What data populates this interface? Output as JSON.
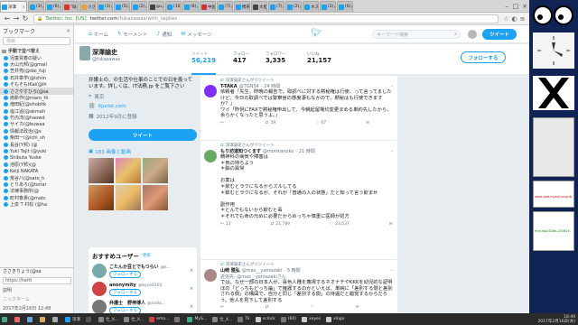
{
  "browser": {
    "tabs": [
      {
        "label": "深澤",
        "color": "#1da1f2",
        "active": true
      },
      {
        "label": "(3)",
        "color": "#1da1f2"
      },
      {
        "label": "(6)",
        "color": "#1da1f2"
      },
      {
        "label": "\"既",
        "color": "#d33"
      },
      {
        "label": "小さ",
        "color": "#e6a23c"
      },
      {
        "label": "(3)",
        "color": "#1da1f2"
      },
      {
        "label": "(5)",
        "color": "#1da1f2"
      },
      {
        "label": "(2)",
        "color": "#1da1f2"
      },
      {
        "label": "gu",
        "color": "#444"
      },
      {
        "label": "(10)",
        "color": "#1da1f2"
      },
      {
        "label": "(8)",
        "color": "#1da1f2"
      },
      {
        "label": "中国",
        "color": "#c33"
      },
      {
        "label": "(7)",
        "color": "#1da1f2"
      },
      {
        "label": "携帯",
        "color": "#1da1f2"
      },
      {
        "label": "大胆",
        "color": "#444"
      },
      {
        "label": "(7)",
        "color": "#1da1f2"
      },
      {
        "label": "(2)",
        "color": "#1da1f2"
      },
      {
        "label": "ネス",
        "color": "#1da1f2"
      },
      {
        "label": "(2)",
        "color": "#1da1f2"
      },
      {
        "label": "(6)",
        "color": "#1da1f2"
      }
    ],
    "url_scheme": "Twitter, Inc. [US]",
    "url_host": "twitter.com",
    "url_path": "/fukazawas/with_replies"
  },
  "bookmarks": {
    "title": "ブックマーク",
    "search_placeholder": "検索",
    "items": [
      {
        "label": "手動で並べ替え",
        "type": "folder"
      },
      {
        "label": "児童買春の疑い",
        "type": "tw"
      },
      {
        "label": "大山元邦(@gmail",
        "type": "tw"
      },
      {
        "label": "笠井亮(@dai_fuji",
        "type": "tw"
      },
      {
        "label": "石井章学(@ishiin",
        "type": "tw"
      },
      {
        "label": "そもそもIKai(@ih",
        "type": "tw"
      },
      {
        "label": "ささやすひろ(@sa",
        "type": "tw",
        "selected": true
      },
      {
        "label": "南新作(@maro_th",
        "type": "tw"
      },
      {
        "label": "増田紀(@shobitk",
        "type": "tw"
      },
      {
        "label": "塩江遥(@akmah",
        "type": "tw"
      },
      {
        "label": "竹内洋(@haowd",
        "type": "tw"
      },
      {
        "label": "サイカ(@buwaa",
        "type": "tw"
      },
      {
        "label": "情報法政治(@s",
        "type": "tw"
      },
      {
        "label": "柴田一(@ichi_sh",
        "type": "tw"
      },
      {
        "label": "長谷(Y邦) (@",
        "type": "tw"
      },
      {
        "label": "Yuki Tajit (@yuki",
        "type": "tw"
      },
      {
        "label": "Shibuta Yuske",
        "type": "tw"
      },
      {
        "label": "池原(Y邦)(@",
        "type": "tw"
      },
      {
        "label": "Keiji NAKATA",
        "type": "tw"
      },
      {
        "label": "荒谷八(@sato_h",
        "type": "tw"
      },
      {
        "label": "とりあろ(@toriar",
        "type": "tw"
      },
      {
        "label": "法律事務所(@",
        "type": "tw"
      },
      {
        "label": "町村泰貴(@matc",
        "type": "tw"
      },
      {
        "label": "上泉 T 村松 (@ha",
        "type": "tw"
      }
    ],
    "footer_item": "ささきりょう(@sa",
    "footer_url": "https://twitt",
    "footer_desc_label": "説明",
    "footer_tag_label": "ニックネーム",
    "footer_date": "2017年2月16日 12:48"
  },
  "twitter": {
    "nav": {
      "home": "ホーム",
      "moments": "モーメント",
      "notifications": "通知",
      "messages": "メッセージ"
    },
    "search_placeholder": "キーワード検索",
    "tweet_button": "ツイート",
    "profile": {
      "name": "深澤諭史",
      "handle": "@fukazawas",
      "stats": [
        {
          "label": "ツイート",
          "value": "56,219",
          "selected": true
        },
        {
          "label": "フォロー",
          "value": "417"
        },
        {
          "label": "フォロワー",
          "value": "3,335"
        },
        {
          "label": "いいね",
          "value": "21,157"
        }
      ],
      "follow_button": "フォローする",
      "bio_text": "弁護士の、の生活や仕事のことでの日を扱っています。詳しくは、IT法務.jp をご覧下さい",
      "bio_link": "IT法務.jp",
      "location": "東京",
      "website": "itjurist.com",
      "joined": "2012年9月に登録",
      "tweet_to": "ツイート",
      "media_label": "183 画像と動画"
    },
    "who_to_follow": {
      "title": "おすすめユーザー",
      "refresh": "更新",
      "view_all": "すべて見る",
      "follow_label": "フォローする",
      "users": [
        {
          "name": "こたんか豆とでもつらい",
          "handle": "@k…",
          "color": "#7aa"
        },
        {
          "name": "anonymity",
          "handle": "@byce0101",
          "color": "#c44"
        },
        {
          "name": "弁護士　野神博人",
          "handle": "@noda…",
          "color": "#777"
        }
      ]
    },
    "tweets": [
      {
        "retweeted_by": "深澤諭史さんがリツイート",
        "name": "T-TAKA",
        "handle": "@TGN54",
        "time": "24 時間",
        "body": "依頼者「先生、昨晩の報告で、取調べに対する黙秘権は行使、って言ってましたけど、今日の取調べでは警察官の態度凄もなかので、黙秘はも行使できますか？」\nワイ「昨例にFAXで黙秘権申出して、今朝起留場均変更まめる単約先したから、余らかくなったと思うよ。」",
        "actions": [
          "",
          "59",
          "67",
          ""
        ],
        "avatar": "#7b2ff7"
      },
      {
        "retweeted_by": "深澤諭史さんがリツイート",
        "name": "もり坊道知つくます",
        "handle": "@morikanoko",
        "time": "21 時間",
        "body": "精神科の病気や障害は\n＊気の持ちよう\n＊脳の異常\n\nお薬は\n＊飲むとラクになるからズルしてる\n＊飲むとラクになるが、それが「普通の人の状態」だと知って言う飲ませ\n\n副作用\n＊とんでもないから飲むと毒\n＊それでも命の元めに必要だからめっちゃ慎重に医師が処方",
        "actions": [
          "13",
          "21,789",
          "23,537",
          ""
        ],
        "avatar": "#6a6"
      },
      {
        "retweeted_by": "深澤諭史さんがリツイート",
        "name": "山崎 雅弘",
        "handle": "@mas__yamazaki",
        "time": "5 時間",
        "reply_to": "返信先: @mas__yamazakiさん",
        "body": "では、なぜ一部の日本人が、喜色人種を蔑視するネオナチやKKKを幼児的な証明ほの「どっちもどっち論」で擁護するのかといえば、単純に「差別する側と差別される側」の構図で、自分と同じ「差別する側」の待遇だと錯覚するからだろう。他人を見下して差別する",
        "actions": [
          "",
          "",
          "",
          ""
        ],
        "avatar": "#a88"
      }
    ]
  },
  "dock": {
    "labels": [
      "west-add-mysql-unig.dr",
      "ntry-wp2016c-201610."
    ]
  },
  "taskbar": {
    "items": [
      {
        "label": "",
        "color": "#4a8"
      },
      {
        "label": "",
        "color": "#e66"
      },
      {
        "label": "",
        "color": "#6ad"
      },
      {
        "label": "",
        "color": "#da6"
      },
      {
        "label": "",
        "color": "#aaa"
      },
      {
        "label": "深澤",
        "color": "#1da1f2"
      },
      {
        "label": "",
        "color": "#555"
      },
      {
        "label": "仕_X...",
        "color": "#888"
      },
      {
        "label": "仕_X...",
        "color": "#888"
      },
      {
        "label": "ema...",
        "color": "#c44"
      },
      {
        "label": "",
        "color": "#777"
      },
      {
        "label": "MyS...",
        "color": "#4a8"
      },
      {
        "label": "仕_X...",
        "color": "#888"
      },
      {
        "label": "Tk",
        "color": "#777"
      },
      {
        "label": "xclock",
        "color": "#ccc"
      },
      {
        "label": "(60)",
        "color": "#777"
      },
      {
        "label": "xeyes",
        "color": "#ccc"
      },
      {
        "label": "xlogo",
        "color": "#ccc"
      }
    ],
    "clock_time": "18:49",
    "clock_date": "2017年2月16日(木)"
  }
}
